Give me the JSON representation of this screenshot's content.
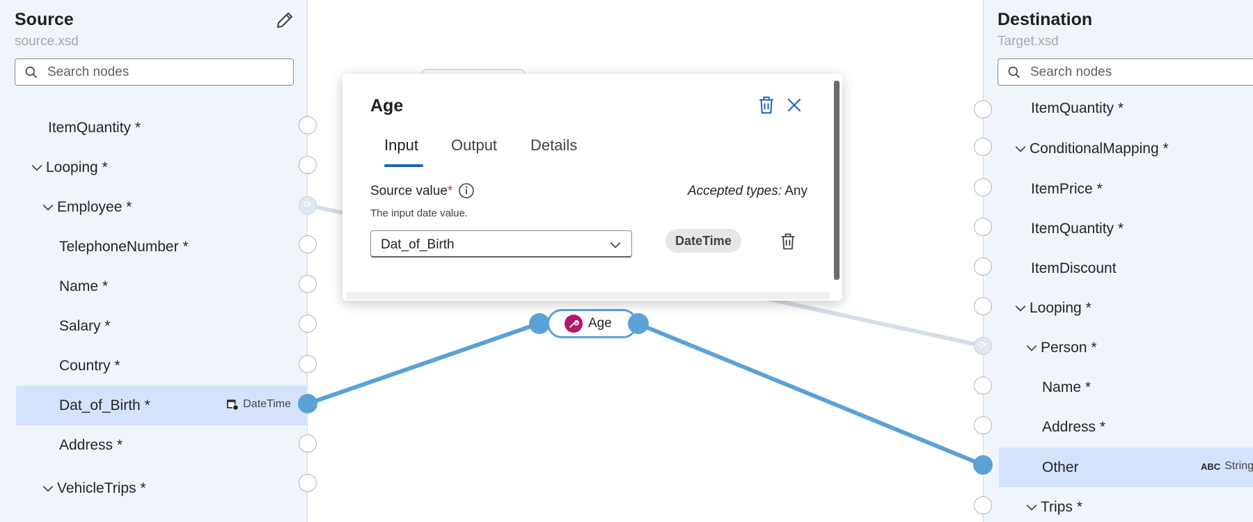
{
  "source": {
    "title": "Source",
    "subtitle": "source.xsd",
    "search_placeholder": "Search nodes",
    "nodes": [
      {
        "label": "ItemQuantity *"
      },
      {
        "label": "Looping *"
      },
      {
        "label": "Employee *"
      },
      {
        "label": "TelephoneNumber *"
      },
      {
        "label": "Name *"
      },
      {
        "label": "Salary *"
      },
      {
        "label": "Country *"
      },
      {
        "label": "Dat_of_Birth *",
        "type": "DateTime"
      },
      {
        "label": "Address *"
      },
      {
        "label": "VehicleTrips *"
      }
    ]
  },
  "destination": {
    "title": "Destination",
    "subtitle": "Target.xsd",
    "search_placeholder": "Search nodes",
    "nodes": [
      {
        "label": "ItemQuantity *"
      },
      {
        "label": "ConditionalMapping *"
      },
      {
        "label": "ItemPrice *"
      },
      {
        "label": "ItemQuantity *"
      },
      {
        "label": "ItemDiscount"
      },
      {
        "label": "Looping *"
      },
      {
        "label": "Person *"
      },
      {
        "label": "Name *"
      },
      {
        "label": "Address *"
      },
      {
        "label": "Other",
        "type": "String"
      },
      {
        "label": "Trips *"
      }
    ]
  },
  "function_node": {
    "label": "Age",
    "icon": "wrench-icon",
    "color": "#b5176a"
  },
  "popup": {
    "title": "Age",
    "tabs": [
      "Input",
      "Output",
      "Details"
    ],
    "active_tab": "Input",
    "field_label": "Source value",
    "required_mark": "*",
    "accepted_label": "Accepted types:",
    "accepted_value": "Any",
    "hint": "The input date value.",
    "selected_value": "Dat_of_Birth",
    "data_type": "DateTime"
  },
  "colors": {
    "accent": "#1d62c0",
    "wire": "#5aa2d6",
    "selected_row": "#d4e3fb",
    "panel_bg": "#f0f5fc"
  }
}
